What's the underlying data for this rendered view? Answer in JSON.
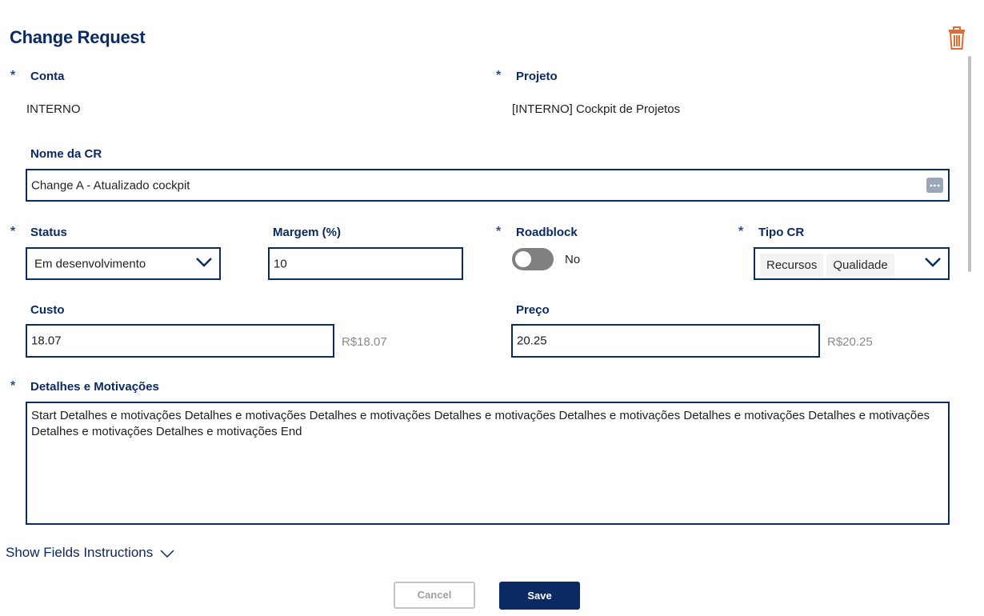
{
  "header": {
    "title": "Change Request",
    "delete_icon": "trash-icon"
  },
  "required_marker": "*",
  "conta": {
    "label": "Conta",
    "value": "INTERNO"
  },
  "projeto": {
    "label": "Projeto",
    "value": "[INTERNO] Cockpit de Projetos"
  },
  "nome_cr": {
    "label": "Nome da CR",
    "value": "Change A - Atualizado cockpit",
    "more_icon": "ellipsis-icon"
  },
  "status": {
    "label": "Status",
    "value": "Em desenvolvimento"
  },
  "margem": {
    "label": "Margem (%)",
    "value": "10"
  },
  "roadblock": {
    "label": "Roadblock",
    "state_label": "No",
    "on": false
  },
  "tipo_cr": {
    "label": "Tipo CR",
    "tags": [
      "Recursos",
      "Qualidade"
    ]
  },
  "custo": {
    "label": "Custo",
    "value": "18.07",
    "formatted": "R$18.07"
  },
  "preco": {
    "label": "Preço",
    "value": "20.25",
    "formatted": "R$20.25"
  },
  "detalhes": {
    "label": "Detalhes e Motivações",
    "value": "Start Detalhes e motivações Detalhes e motivações Detalhes e motivações Detalhes e motivações Detalhes e motivações Detalhes e motivações Detalhes e motivações Detalhes e motivações Detalhes e motivações End"
  },
  "instructions": {
    "label": "Show Fields Instructions"
  },
  "buttons": {
    "cancel": "Cancel",
    "save": "Save"
  },
  "colors": {
    "primary": "#0b2a63",
    "delete": "#e8692e",
    "toggle_off": "#808080",
    "muted": "#8a8a8a"
  }
}
